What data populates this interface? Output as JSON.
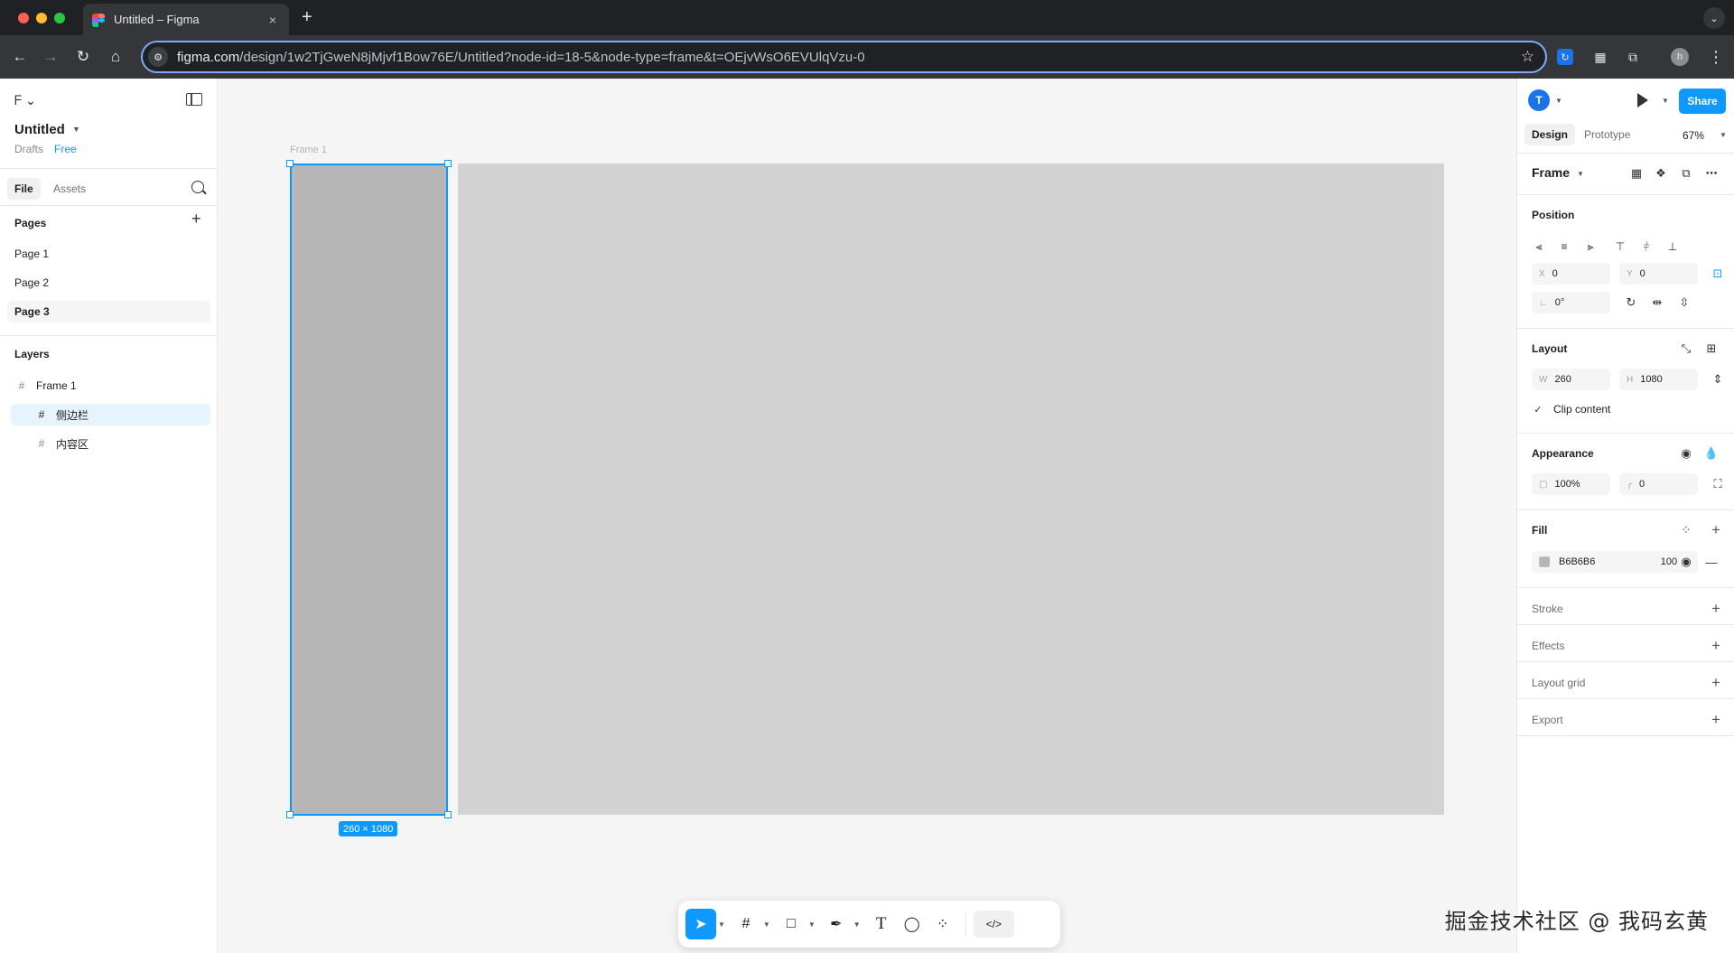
{
  "browser": {
    "tab_title": "Untitled – Figma",
    "tab_close": "×",
    "new_tab": "+",
    "url_host": "figma.com",
    "url_path": "/design/1w2TjGweN8jMjvf1Bow76E/Untitled?node-id=18-5&node-type=frame&t=OEjvWsO6EVUlqVzu-0",
    "profile_initial": "h"
  },
  "left_panel": {
    "file_title": "Untitled",
    "file_location": "Drafts",
    "plan_badge": "Free",
    "tabs": [
      "File",
      "Assets"
    ],
    "pages_title": "Pages",
    "pages": [
      "Page 1",
      "Page 2",
      "Page 3"
    ],
    "active_page": "Page 3",
    "layers_title": "Layers",
    "layers": [
      {
        "name": "Frame 1",
        "depth": 0
      },
      {
        "name": "侧边栏",
        "depth": 1,
        "selected": true
      },
      {
        "name": "内容区",
        "depth": 1
      }
    ]
  },
  "canvas": {
    "frame_label": "Frame 1",
    "selection_size": "260 × 1080",
    "sidebar_color": "#B6B6B6",
    "content_color": "#D3D3D3",
    "selection_color": "#0D99FF"
  },
  "right_panel": {
    "user_initial": "T",
    "share_label": "Share",
    "tabs": [
      "Design",
      "Prototype"
    ],
    "zoom": "67%",
    "frame_title": "Frame",
    "position_title": "Position",
    "x_label": "X",
    "x_value": "0",
    "y_label": "Y",
    "y_value": "0",
    "rotation_value": "0°",
    "layout_title": "Layout",
    "w_label": "W",
    "w_value": "260",
    "h_label": "H",
    "h_value": "1080",
    "clip_content": "Clip content",
    "appearance_title": "Appearance",
    "opacity": "100%",
    "radius": "0",
    "fill_title": "Fill",
    "fill_hex": "B6B6B6",
    "fill_opacity": "100",
    "fill_opacity_unit": "%",
    "stroke_title": "Stroke",
    "effects_title": "Effects",
    "layout_grid_title": "Layout grid",
    "export_title": "Export"
  },
  "watermark": "掘金技术社区 @ 我码玄黄"
}
